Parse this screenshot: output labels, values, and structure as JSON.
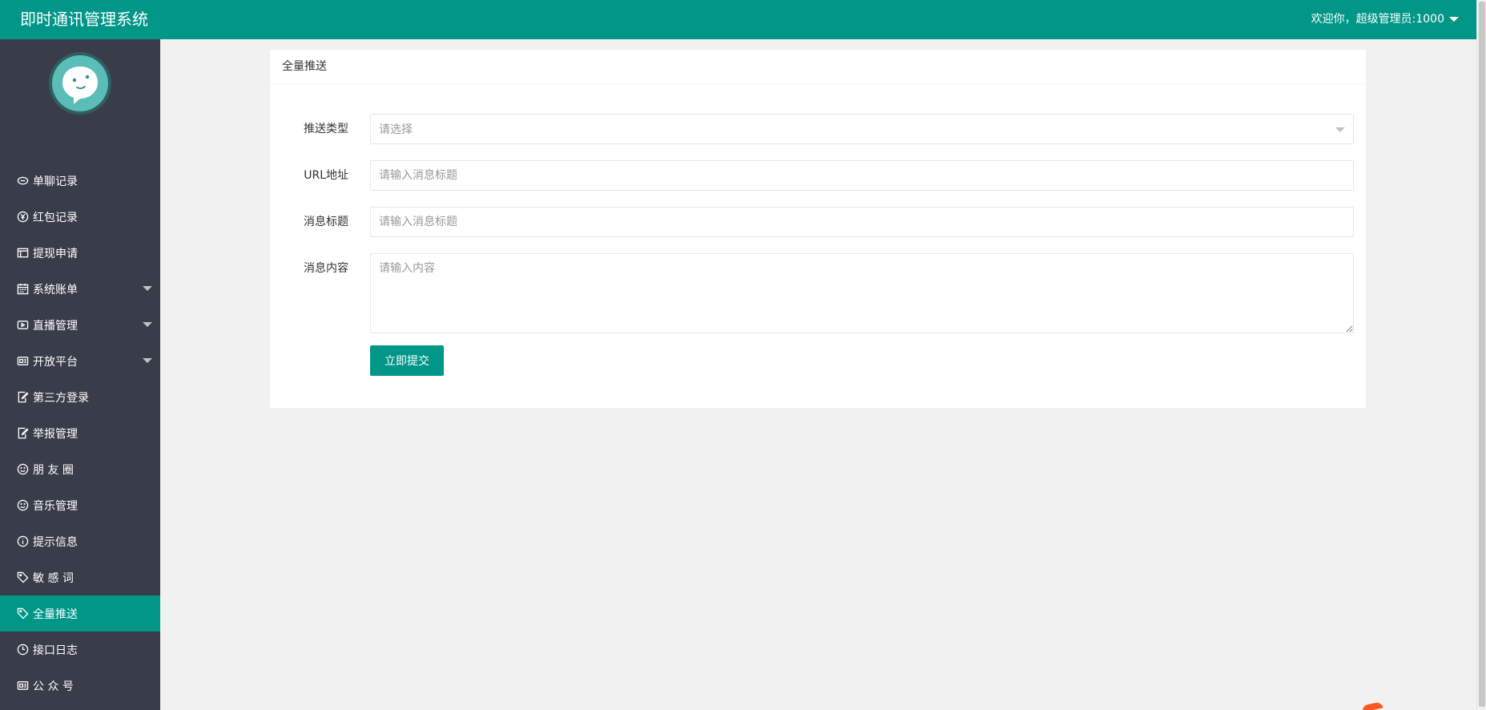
{
  "header": {
    "app_title": "即时通讯管理系统",
    "user_greeting": "欢迎你，超级管理员:1000"
  },
  "colors": {
    "brand": "#009688",
    "sidebar_bg": "#393d49",
    "page_bg": "#f1f1f1"
  },
  "sidebar": {
    "logo_icon": "chat-bubble-face-logo",
    "items": [
      {
        "label": "单聊记录",
        "icon": "chat-icon",
        "has_submenu": false
      },
      {
        "label": "红包记录",
        "icon": "yuan-icon",
        "has_submenu": false
      },
      {
        "label": "提现申请",
        "icon": "table-icon",
        "has_submenu": false
      },
      {
        "label": "系统账单",
        "icon": "calendar-icon",
        "has_submenu": true
      },
      {
        "label": "直播管理",
        "icon": "video-icon",
        "has_submenu": true
      },
      {
        "label": "开放平台",
        "icon": "app-icon",
        "has_submenu": true
      },
      {
        "label": "第三方登录",
        "icon": "edit-icon",
        "has_submenu": false
      },
      {
        "label": "举报管理",
        "icon": "edit-icon",
        "has_submenu": false
      },
      {
        "label": "朋 友 圈",
        "icon": "smile-icon",
        "has_submenu": false
      },
      {
        "label": "音乐管理",
        "icon": "smile-icon",
        "has_submenu": false
      },
      {
        "label": "提示信息",
        "icon": "info-icon",
        "has_submenu": false
      },
      {
        "label": "敏 感 词",
        "icon": "tag-icon",
        "has_submenu": false
      },
      {
        "label": "全量推送",
        "icon": "tag-icon",
        "has_submenu": false,
        "active": true
      },
      {
        "label": "接口日志",
        "icon": "clock-icon",
        "has_submenu": false
      },
      {
        "label": "公 众 号",
        "icon": "app-icon",
        "has_submenu": false
      }
    ]
  },
  "main": {
    "card_title": "全量推送",
    "form": {
      "push_type": {
        "label": "推送类型",
        "placeholder": "请选择"
      },
      "url": {
        "label": "URL地址",
        "placeholder": "请输入消息标题"
      },
      "title": {
        "label": "消息标题",
        "placeholder": "请输入消息标题"
      },
      "content": {
        "label": "消息内容",
        "placeholder": "请输入内容"
      },
      "submit_label": "立即提交"
    }
  }
}
